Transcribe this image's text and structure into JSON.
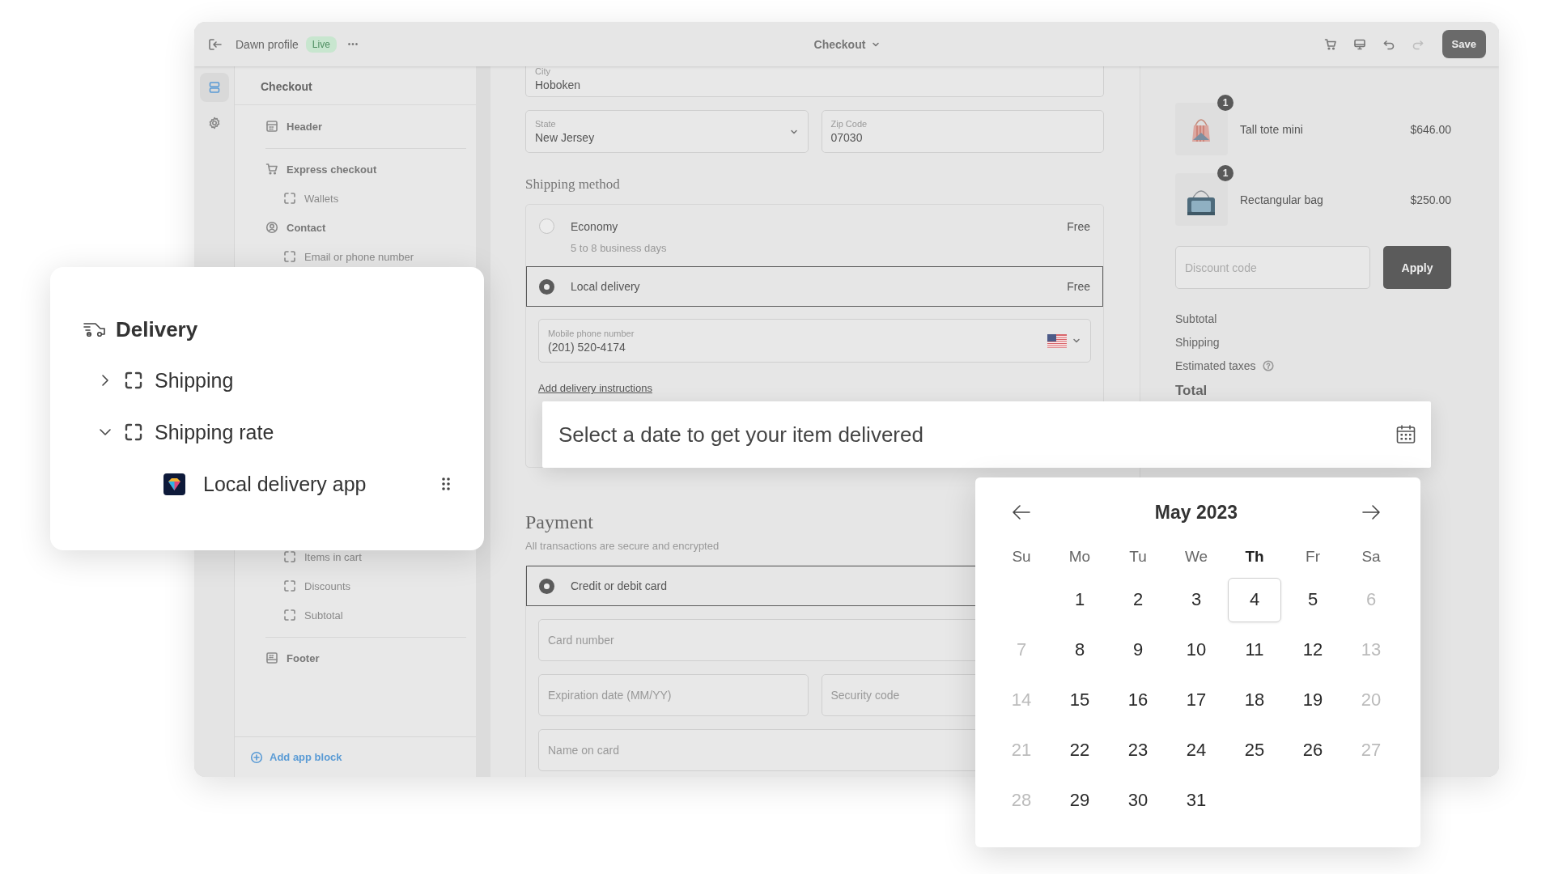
{
  "topbar": {
    "profile": "Dawn profile",
    "badge": "Live",
    "more": "•••",
    "page_selector": "Checkout",
    "tools": [
      {
        "kind": "cart",
        "disabled": false
      },
      {
        "kind": "monitor",
        "disabled": false
      },
      {
        "kind": "undo",
        "disabled": false
      },
      {
        "kind": "redo",
        "disabled": true
      }
    ],
    "save": "Save"
  },
  "rail": [
    {
      "kind": "sections",
      "selected": true
    },
    {
      "kind": "settings",
      "selected": false
    }
  ],
  "sidebar": {
    "title": "Checkout",
    "items_top": [
      {
        "label": "Header",
        "kind": "header"
      },
      {
        "label": "Express checkout",
        "kind": "express"
      },
      {
        "label": "Wallets",
        "kind": "block"
      },
      {
        "label": "Contact",
        "kind": "contact"
      },
      {
        "label": "Email or phone number",
        "kind": "block"
      }
    ],
    "items_bottom": [
      {
        "label": "Items in cart",
        "kind": "block"
      },
      {
        "label": "Discounts",
        "kind": "block"
      },
      {
        "label": "Subtotal",
        "kind": "block"
      },
      {
        "label": "Footer",
        "kind": "footer"
      }
    ],
    "add_block": "Add app block"
  },
  "address": {
    "city": {
      "label": "City",
      "value": "Hoboken"
    },
    "state": {
      "label": "State",
      "value": "New Jersey"
    },
    "zip": {
      "label": "Zip Code",
      "value": "07030"
    }
  },
  "shipping": {
    "heading": "Shipping method",
    "options": [
      {
        "label": "Economy",
        "detail": "5 to 8 business days",
        "price": "Free",
        "selected": false
      },
      {
        "label": "Local delivery",
        "price": "Free",
        "selected": true
      }
    ],
    "phone": {
      "label": "Mobile phone number",
      "value": "(201) 520-4174"
    },
    "instructions_link": "Add delivery instructions"
  },
  "payment": {
    "heading": "Payment",
    "note": "All transactions are secure and encrypted",
    "options": [
      {
        "label": "Credit or debit card",
        "selected": true
      }
    ],
    "field_rows": [
      [
        {
          "placeholder": "Card number"
        }
      ],
      [
        {
          "placeholder": "Expiration date (MM/YY)"
        },
        {
          "placeholder": "Security code"
        }
      ],
      [
        {
          "placeholder": "Name on card"
        }
      ]
    ]
  },
  "summary": {
    "items": [
      {
        "name": "Tall tote mini",
        "price": "$646.00",
        "quantity": "1",
        "kind": "tote"
      },
      {
        "name": "Rectangular bag",
        "price": "$250.00",
        "quantity": "1",
        "kind": "rect"
      }
    ],
    "discount": {
      "placeholder": "Discount code",
      "button": "Apply"
    },
    "totals": [
      {
        "label": "Subtotal",
        "info": false,
        "kind": "line"
      },
      {
        "label": "Shipping",
        "info": false,
        "kind": "line"
      },
      {
        "label": "Estimated taxes",
        "info": true,
        "kind": "line"
      },
      {
        "label": "Total",
        "info": false,
        "kind": "total"
      }
    ]
  },
  "delivery_card": {
    "title": "Delivery",
    "children": [
      {
        "label": "Shipping",
        "expanded": false
      },
      {
        "label": "Shipping rate",
        "expanded": true,
        "children": [
          {
            "label": "Local delivery app",
            "kind": "app"
          }
        ]
      }
    ]
  },
  "date_field": {
    "placeholder": "Select a date to get your item delivered"
  },
  "calendar": {
    "month": "May 2023",
    "weekdays": [
      {
        "label": "Su",
        "current": false
      },
      {
        "label": "Mo",
        "current": false
      },
      {
        "label": "Tu",
        "current": false
      },
      {
        "label": "We",
        "current": false
      },
      {
        "label": "Th",
        "current": true
      },
      {
        "label": "Fr",
        "current": false
      },
      {
        "label": "Sa",
        "current": false
      }
    ],
    "weeks": [
      [
        {
          "kind": "blank"
        },
        {
          "kind": "day",
          "label": "1",
          "disabled": false,
          "selected": false
        },
        {
          "kind": "day",
          "label": "2",
          "disabled": false,
          "selected": false
        },
        {
          "kind": "day",
          "label": "3",
          "disabled": false,
          "selected": false
        },
        {
          "kind": "day",
          "label": "4",
          "disabled": false,
          "selected": true
        },
        {
          "kind": "day",
          "label": "5",
          "disabled": false,
          "selected": false
        },
        {
          "kind": "day",
          "label": "6",
          "disabled": true,
          "selected": false
        }
      ],
      [
        {
          "kind": "day",
          "label": "7",
          "disabled": true,
          "selected": false
        },
        {
          "kind": "day",
          "label": "8",
          "disabled": false,
          "selected": false
        },
        {
          "kind": "day",
          "label": "9",
          "disabled": false,
          "selected": false
        },
        {
          "kind": "day",
          "label": "10",
          "disabled": false,
          "selected": false
        },
        {
          "kind": "day",
          "label": "11",
          "disabled": false,
          "selected": false
        },
        {
          "kind": "day",
          "label": "12",
          "disabled": false,
          "selected": false
        },
        {
          "kind": "day",
          "label": "13",
          "disabled": true,
          "selected": false
        }
      ],
      [
        {
          "kind": "day",
          "label": "14",
          "disabled": true,
          "selected": false
        },
        {
          "kind": "day",
          "label": "15",
          "disabled": false,
          "selected": false
        },
        {
          "kind": "day",
          "label": "16",
          "disabled": false,
          "selected": false
        },
        {
          "kind": "day",
          "label": "17",
          "disabled": false,
          "selected": false
        },
        {
          "kind": "day",
          "label": "18",
          "disabled": false,
          "selected": false
        },
        {
          "kind": "day",
          "label": "19",
          "disabled": false,
          "selected": false
        },
        {
          "kind": "day",
          "label": "20",
          "disabled": true,
          "selected": false
        }
      ],
      [
        {
          "kind": "day",
          "label": "21",
          "disabled": true,
          "selected": false
        },
        {
          "kind": "day",
          "label": "22",
          "disabled": false,
          "selected": false
        },
        {
          "kind": "day",
          "label": "23",
          "disabled": false,
          "selected": false
        },
        {
          "kind": "day",
          "label": "24",
          "disabled": false,
          "selected": false
        },
        {
          "kind": "day",
          "label": "25",
          "disabled": false,
          "selected": false
        },
        {
          "kind": "day",
          "label": "26",
          "disabled": false,
          "selected": false
        },
        {
          "kind": "day",
          "label": "27",
          "disabled": true,
          "selected": false
        }
      ],
      [
        {
          "kind": "day",
          "label": "28",
          "disabled": true,
          "selected": false
        },
        {
          "kind": "day",
          "label": "29",
          "disabled": false,
          "selected": false
        },
        {
          "kind": "day",
          "label": "30",
          "disabled": false,
          "selected": false
        },
        {
          "kind": "day",
          "label": "31",
          "disabled": false,
          "selected": false
        }
      ]
    ]
  }
}
